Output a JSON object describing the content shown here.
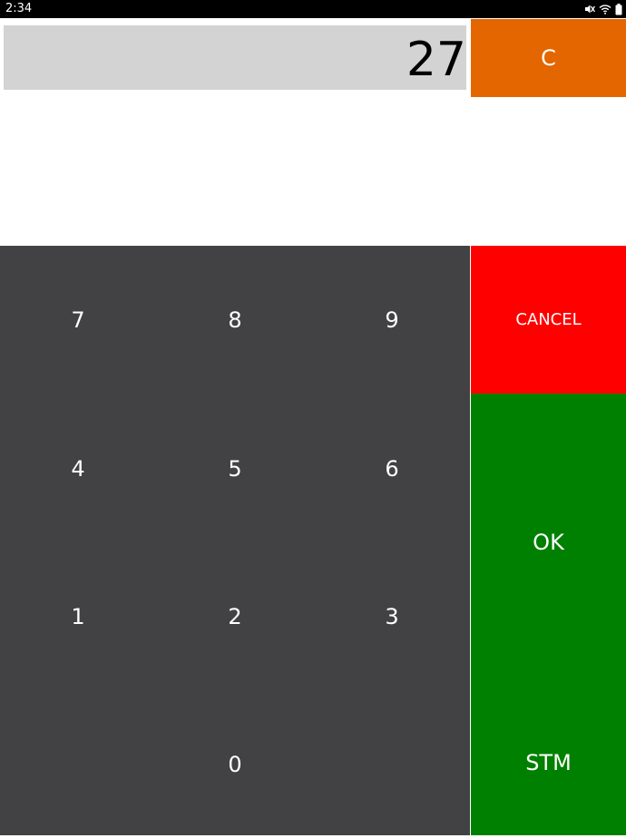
{
  "status_bar": {
    "time": "2:34",
    "icons": [
      "mute-icon",
      "wifi-icon",
      "battery-icon"
    ]
  },
  "display": {
    "value": "27"
  },
  "buttons": {
    "clear": "C",
    "cancel": "CANCEL",
    "ok": "OK",
    "stm": "STM"
  },
  "keypad": {
    "keys": [
      "7",
      "8",
      "9",
      "4",
      "5",
      "6",
      "1",
      "2",
      "3",
      "0"
    ]
  },
  "colors": {
    "status_bar_bg": "#000000",
    "display_bg": "#d3d3d3",
    "clear_bg": "#e46600",
    "keypad_bg": "#424244",
    "cancel_bg": "#ff0000",
    "ok_stm_bg": "#008000",
    "label_text": "#ffffff"
  }
}
